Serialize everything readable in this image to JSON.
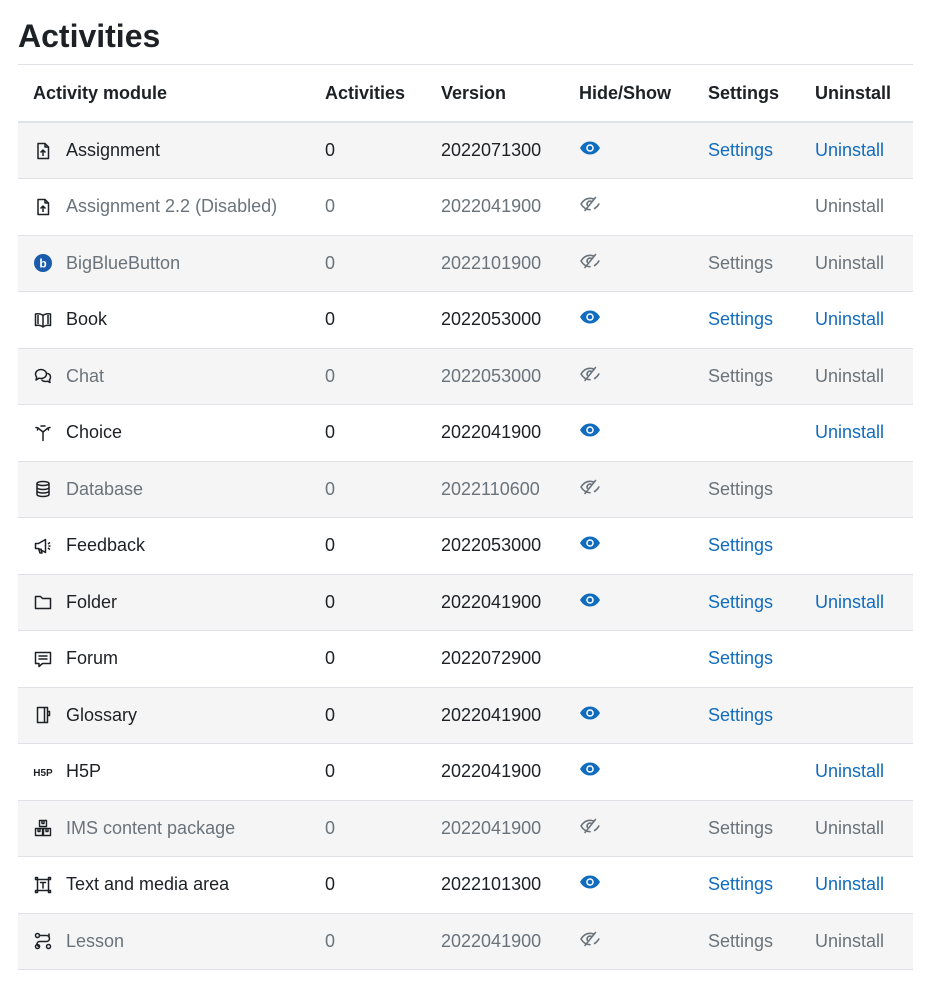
{
  "page": {
    "title": "Activities"
  },
  "table": {
    "headers": {
      "module": "Activity module",
      "activities": "Activities",
      "version": "Version",
      "hideshow": "Hide/Show",
      "settings": "Settings",
      "uninstall": "Uninstall"
    },
    "rows": [
      {
        "name": "Assignment",
        "icon": "assignment-icon",
        "count": "0",
        "version": "2022071300",
        "visibility": "shown",
        "settings": "Settings",
        "settings_state": "link",
        "uninstall": "Uninstall",
        "uninstall_state": "link",
        "disabled": false
      },
      {
        "name": "Assignment 2.2 (Disabled)",
        "icon": "assignment-icon",
        "count": "0",
        "version": "2022041900",
        "visibility": "hidden",
        "settings": "",
        "settings_state": "none",
        "uninstall": "Uninstall",
        "uninstall_state": "muted",
        "disabled": true
      },
      {
        "name": "BigBlueButton",
        "icon": "bigbluebutton-icon",
        "count": "0",
        "version": "2022101900",
        "visibility": "hidden",
        "settings": "Settings",
        "settings_state": "muted",
        "uninstall": "Uninstall",
        "uninstall_state": "muted",
        "disabled": true
      },
      {
        "name": "Book",
        "icon": "book-icon",
        "count": "0",
        "version": "2022053000",
        "visibility": "shown",
        "settings": "Settings",
        "settings_state": "link",
        "uninstall": "Uninstall",
        "uninstall_state": "link",
        "disabled": false
      },
      {
        "name": "Chat",
        "icon": "chat-icon",
        "count": "0",
        "version": "2022053000",
        "visibility": "hidden",
        "settings": "Settings",
        "settings_state": "muted",
        "uninstall": "Uninstall",
        "uninstall_state": "muted",
        "disabled": true
      },
      {
        "name": "Choice",
        "icon": "choice-icon",
        "count": "0",
        "version": "2022041900",
        "visibility": "shown",
        "settings": "",
        "settings_state": "none",
        "uninstall": "Uninstall",
        "uninstall_state": "link",
        "disabled": false
      },
      {
        "name": "Database",
        "icon": "database-icon",
        "count": "0",
        "version": "2022110600",
        "visibility": "hidden",
        "settings": "Settings",
        "settings_state": "muted",
        "uninstall": "",
        "uninstall_state": "none",
        "disabled": true
      },
      {
        "name": "Feedback",
        "icon": "feedback-icon",
        "count": "0",
        "version": "2022053000",
        "visibility": "shown",
        "settings": "Settings",
        "settings_state": "link",
        "uninstall": "",
        "uninstall_state": "none",
        "disabled": false
      },
      {
        "name": "Folder",
        "icon": "folder-icon",
        "count": "0",
        "version": "2022041900",
        "visibility": "shown",
        "settings": "Settings",
        "settings_state": "link",
        "uninstall": "Uninstall",
        "uninstall_state": "link",
        "disabled": false
      },
      {
        "name": "Forum",
        "icon": "forum-icon",
        "count": "0",
        "version": "2022072900",
        "visibility": "none",
        "settings": "Settings",
        "settings_state": "link",
        "uninstall": "",
        "uninstall_state": "none",
        "disabled": false
      },
      {
        "name": "Glossary",
        "icon": "glossary-icon",
        "count": "0",
        "version": "2022041900",
        "visibility": "shown",
        "settings": "Settings",
        "settings_state": "link",
        "uninstall": "",
        "uninstall_state": "none",
        "disabled": false
      },
      {
        "name": "H5P",
        "icon": "h5p-icon",
        "count": "0",
        "version": "2022041900",
        "visibility": "shown",
        "settings": "",
        "settings_state": "none",
        "uninstall": "Uninstall",
        "uninstall_state": "link",
        "disabled": false
      },
      {
        "name": "IMS content package",
        "icon": "ims-package-icon",
        "count": "0",
        "version": "2022041900",
        "visibility": "hidden",
        "settings": "Settings",
        "settings_state": "muted",
        "uninstall": "Uninstall",
        "uninstall_state": "muted",
        "disabled": true
      },
      {
        "name": "Text and media area",
        "icon": "text-media-icon",
        "count": "0",
        "version": "2022101300",
        "visibility": "shown",
        "settings": "Settings",
        "settings_state": "link",
        "uninstall": "Uninstall",
        "uninstall_state": "link",
        "disabled": false
      },
      {
        "name": "Lesson",
        "icon": "lesson-icon",
        "count": "0",
        "version": "2022041900",
        "visibility": "hidden",
        "settings": "Settings",
        "settings_state": "muted",
        "uninstall": "Uninstall",
        "uninstall_state": "muted",
        "disabled": true
      }
    ]
  },
  "colors": {
    "link": "#0f6cbf",
    "muted": "#6a737b",
    "text": "#1d2125",
    "stripe": "#f5f5f5",
    "rule": "#dee2e6",
    "bbb_badge": "#1a5cab"
  }
}
